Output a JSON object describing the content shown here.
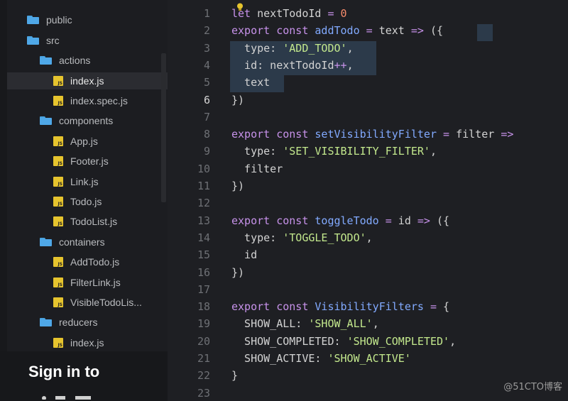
{
  "sidebar": {
    "items": [
      {
        "label": "public",
        "type": "folder"
      },
      {
        "label": "src",
        "type": "folder"
      },
      {
        "label": "actions",
        "type": "folder"
      },
      {
        "label": "index.js",
        "type": "js",
        "selected": true
      },
      {
        "label": "index.spec.js",
        "type": "js"
      },
      {
        "label": "components",
        "type": "folder"
      },
      {
        "label": "App.js",
        "type": "js"
      },
      {
        "label": "Footer.js",
        "type": "js"
      },
      {
        "label": "Link.js",
        "type": "js"
      },
      {
        "label": "Todo.js",
        "type": "js"
      },
      {
        "label": "TodoList.js",
        "type": "js"
      },
      {
        "label": "containers",
        "type": "folder"
      },
      {
        "label": "AddTodo.js",
        "type": "js"
      },
      {
        "label": "FilterLink.js",
        "type": "js"
      },
      {
        "label": "VisibleTodoLis...",
        "type": "js"
      },
      {
        "label": "reducers",
        "type": "folder"
      },
      {
        "label": "index.js",
        "type": "js"
      }
    ],
    "js_badge": "JS",
    "signin_title": "Sign in to"
  },
  "editor": {
    "active_line": 6,
    "line_numbers": [
      "1",
      "2",
      "3",
      "4",
      "5",
      "6",
      "7",
      "8",
      "9",
      "10",
      "11",
      "12",
      "13",
      "14",
      "15",
      "16",
      "17",
      "18",
      "19",
      "20",
      "21",
      "22",
      "23"
    ],
    "code": [
      "let nextTodoId = 0",
      "export const addTodo = text => ({",
      "  type: 'ADD_TODO',",
      "  id: nextTodoId++,",
      "  text",
      "})",
      "",
      "export const setVisibilityFilter = filter =>",
      "  type: 'SET_VISIBILITY_FILTER',",
      "  filter",
      "})",
      "",
      "export const toggleTodo = id => ({",
      "  type: 'TOGGLE_TODO',",
      "  id",
      "})",
      "",
      "export const VisibilityFilters = {",
      "  SHOW_ALL: 'SHOW_ALL',",
      "  SHOW_COMPLETED: 'SHOW_COMPLETED',",
      "  SHOW_ACTIVE: 'SHOW_ACTIVE'",
      "}",
      ""
    ]
  },
  "watermark": "@51CTO博客",
  "colors": {
    "keyword": "#c792ea",
    "function": "#82aaff",
    "string": "#c3e88d",
    "number": "#f78c6c",
    "folder": "#4fa8e8",
    "js_icon": "#e6c42e"
  }
}
